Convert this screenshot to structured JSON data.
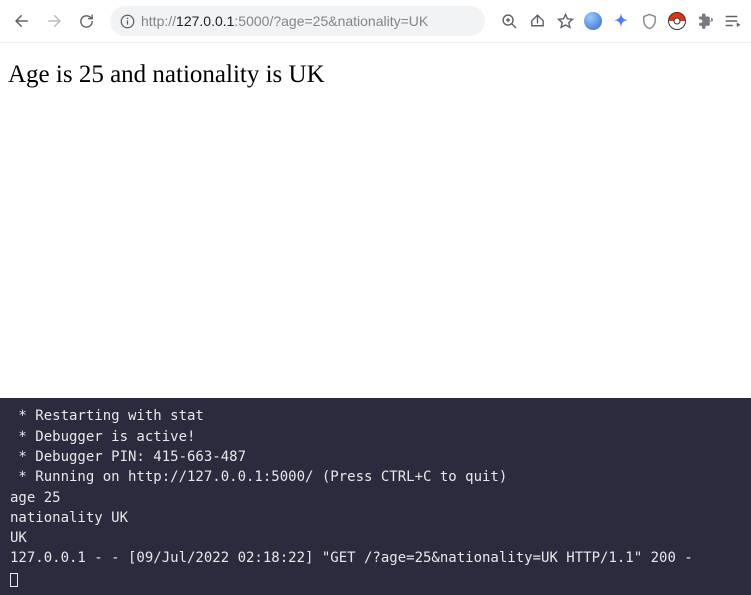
{
  "toolbar": {
    "url_scheme": "http://",
    "url_host": "127.0.0.1",
    "url_port_path": ":5000/?age=25&nationality=UK"
  },
  "page": {
    "heading": "Age is 25 and nationality is UK"
  },
  "terminal": {
    "lines": [
      " * Restarting with stat",
      " * Debugger is active!",
      " * Debugger PIN: 415-663-487",
      " * Running on http://127.0.0.1:5000/ (Press CTRL+C to quit)",
      "age 25",
      "nationality UK",
      "UK",
      "127.0.0.1 - - [09/Jul/2022 02:18:22] \"GET /?age=25&nationality=UK HTTP/1.1\" 200 -"
    ]
  }
}
